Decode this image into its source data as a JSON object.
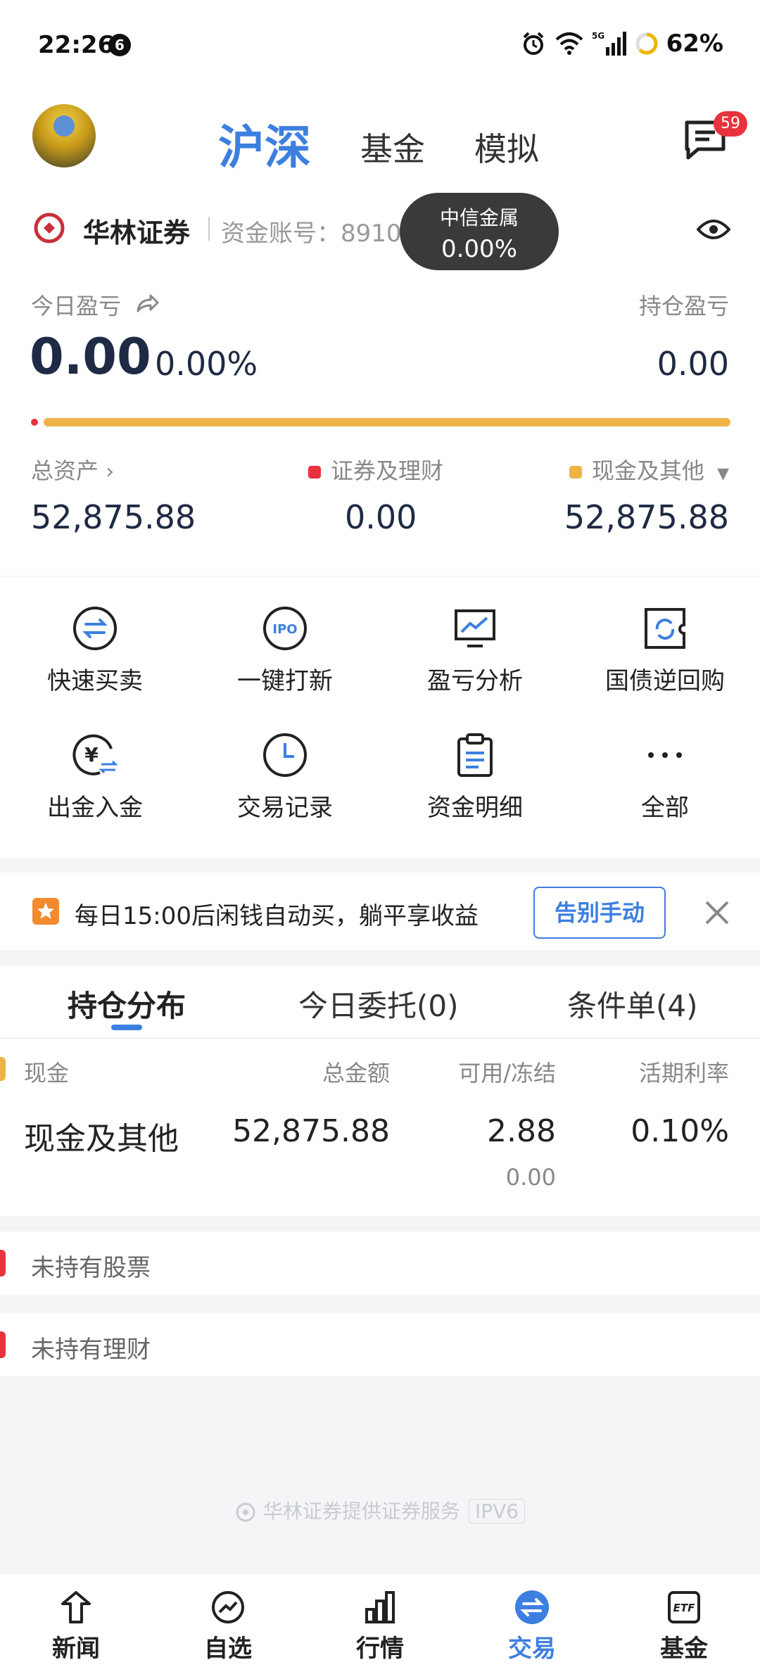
{
  "status_bar": {
    "time": "22:26",
    "notification_count": "6",
    "battery_percent": "62%"
  },
  "top_nav": {
    "tabs": [
      {
        "label": "沪深",
        "active": true
      },
      {
        "label": "基金",
        "active": false
      },
      {
        "label": "模拟",
        "active": false
      }
    ],
    "message_badge": "59"
  },
  "account": {
    "broker_name": "华林证券",
    "account_label": "资金账号：89100710",
    "tooltip_title": "中信金属",
    "tooltip_value": "0.00%",
    "today_pnl_label": "今日盈亏",
    "today_pnl_value": "0.00",
    "today_pnl_pct": "0.00%",
    "position_pnl_label": "持仓盈亏",
    "position_pnl_value": "0.00",
    "securities_share": 0.0,
    "total_assets_label": "总资产",
    "total_assets_value": "52,875.88",
    "securities_label": "证券及理财",
    "securities_value": "0.00",
    "cash_label": "现金及其他",
    "cash_value": "52,875.88"
  },
  "actions": [
    {
      "label": "快速买卖",
      "icon": "swap-circle-icon"
    },
    {
      "label": "一键打新",
      "icon": "ipo-icon"
    },
    {
      "label": "盈亏分析",
      "icon": "chart-monitor-icon"
    },
    {
      "label": "国债逆回购",
      "icon": "reverse-repo-icon"
    },
    {
      "label": "出金入金",
      "icon": "yuan-transfer-icon"
    },
    {
      "label": "交易记录",
      "icon": "clock-icon"
    },
    {
      "label": "资金明细",
      "icon": "clipboard-icon"
    },
    {
      "label": "全部",
      "icon": "more-icon"
    }
  ],
  "promo": {
    "text": "每日15:00后闲钱自动买，躺平享收益",
    "button": "告别手动"
  },
  "holdings": {
    "tabs": [
      {
        "label": "持仓分布",
        "active": true
      },
      {
        "label": "今日委托(0)",
        "active": false
      },
      {
        "label": "条件单(4)",
        "active": false
      }
    ],
    "columns": [
      "现金",
      "总金额",
      "可用/冻结",
      "活期利率"
    ],
    "row": {
      "name": "现金及其他",
      "total": "52,875.88",
      "available": "2.88",
      "frozen": "0.00",
      "rate": "0.10%"
    },
    "no_stock": "未持有股票",
    "no_wealth": "未持有理财"
  },
  "footer": {
    "note": "华林证券提供证券服务",
    "tag": "IPV6"
  },
  "tab_bar": [
    {
      "label": "新闻",
      "icon": "news-icon",
      "active": false
    },
    {
      "label": "自选",
      "icon": "watchlist-icon",
      "active": false
    },
    {
      "label": "行情",
      "icon": "market-icon",
      "active": false
    },
    {
      "label": "交易",
      "icon": "trade-icon",
      "active": true
    },
    {
      "label": "基金",
      "icon": "etf-icon",
      "active": false
    }
  ],
  "colors": {
    "accent": "#3d7fe0",
    "red": "#e8333c",
    "gold": "#eeb347",
    "dark_text": "#1f2a44"
  }
}
